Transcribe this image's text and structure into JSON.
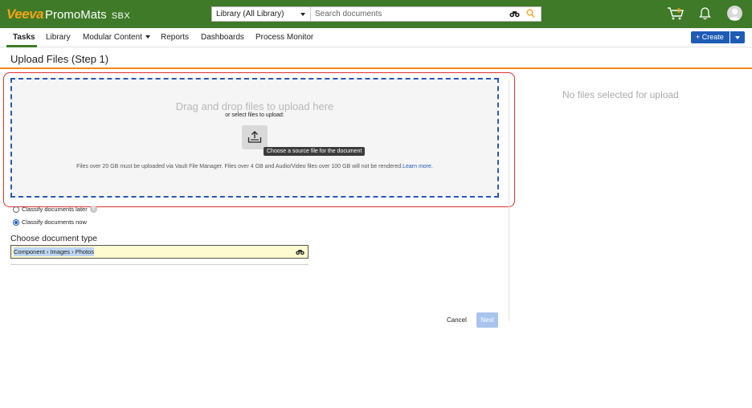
{
  "app": {
    "logo_brand": "Veeva",
    "logo_product": "PromoMats",
    "environment": "SBX"
  },
  "header": {
    "library_select": "Library (All Library)",
    "search_placeholder": "Search documents",
    "cart_count": "0"
  },
  "nav": {
    "items": [
      {
        "label": "Tasks",
        "active": true
      },
      {
        "label": "Library"
      },
      {
        "label": "Modular Content",
        "has_dropdown": true
      },
      {
        "label": "Reports"
      },
      {
        "label": "Dashboards"
      },
      {
        "label": "Process Monitor"
      }
    ],
    "create_label": "+ Create"
  },
  "page": {
    "title": "Upload Files (Step 1)"
  },
  "dropzone": {
    "main_text": "Drag and drop files to upload here",
    "sub_text": "or select files to upload:",
    "tooltip": "Choose a source file for the document",
    "note_text": "Files over 20 GB must be uploaded via Vault File Manager. Files over 4 GB and Audio/Video files over 100 GB will not be rendered.",
    "learn_more": "Learn more."
  },
  "right_panel": {
    "empty_text": "No files selected for upload"
  },
  "classify": {
    "later_label": "Classify documents later",
    "now_label": "Classify documents now",
    "selected": "now"
  },
  "doc_type": {
    "label": "Choose document type",
    "value": "Component › Images › Photos"
  },
  "footer": {
    "cancel": "Cancel",
    "next": "Next"
  },
  "colors": {
    "topbar": "#3e7a27",
    "brand_orange": "#f6a21a",
    "accent_blue": "#1e5bb4",
    "rule_orange": "#f08a1c",
    "highlight_red": "#e0312f"
  }
}
